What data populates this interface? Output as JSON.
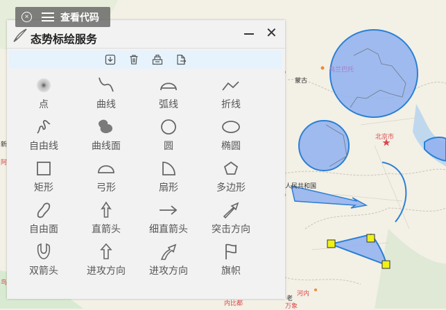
{
  "code_button": {
    "label": "查看代码",
    "close_icon": "close-circle-icon",
    "menu_icon": "hamburger-icon"
  },
  "panel": {
    "title": "态势标绘服务",
    "toolbar": [
      "import-icon",
      "trash-icon",
      "save-icon",
      "export-icon"
    ],
    "tools": [
      {
        "label": "点",
        "icon": "point-icon"
      },
      {
        "label": "曲线",
        "icon": "curve-icon"
      },
      {
        "label": "弧线",
        "icon": "arc-icon"
      },
      {
        "label": "折线",
        "icon": "polyline-icon"
      },
      {
        "label": "自由线",
        "icon": "freeline-icon"
      },
      {
        "label": "曲线面",
        "icon": "curve-polygon-icon"
      },
      {
        "label": "圆",
        "icon": "circle-icon"
      },
      {
        "label": "椭圆",
        "icon": "ellipse-icon"
      },
      {
        "label": "矩形",
        "icon": "rectangle-icon"
      },
      {
        "label": "弓形",
        "icon": "bow-icon"
      },
      {
        "label": "扇形",
        "icon": "sector-icon"
      },
      {
        "label": "多边形",
        "icon": "polygon-icon"
      },
      {
        "label": "自由面",
        "icon": "free-polygon-icon"
      },
      {
        "label": "直箭头",
        "icon": "straight-arrow-icon"
      },
      {
        "label": "细直箭头",
        "icon": "thin-arrow-icon"
      },
      {
        "label": "突击方向",
        "icon": "assault-direction-icon"
      },
      {
        "label": "双箭头",
        "icon": "double-arrow-icon"
      },
      {
        "label": "进攻方向",
        "icon": "attack-direction-icon"
      },
      {
        "label": "进攻方向",
        "icon": "attack-direction-tail-icon"
      },
      {
        "label": "旗帜",
        "icon": "flag-icon"
      }
    ]
  },
  "map": {
    "labels": [
      "蒙古",
      "乌兰巴托",
      "北京市",
      "人民共和国",
      "河内",
      "老",
      "万象",
      "内比都",
      "新",
      "阿",
      "鸟"
    ],
    "fill_color": "#8fb0ee",
    "stroke_color": "#2a7fd4",
    "handle_color": "#f1f116"
  }
}
